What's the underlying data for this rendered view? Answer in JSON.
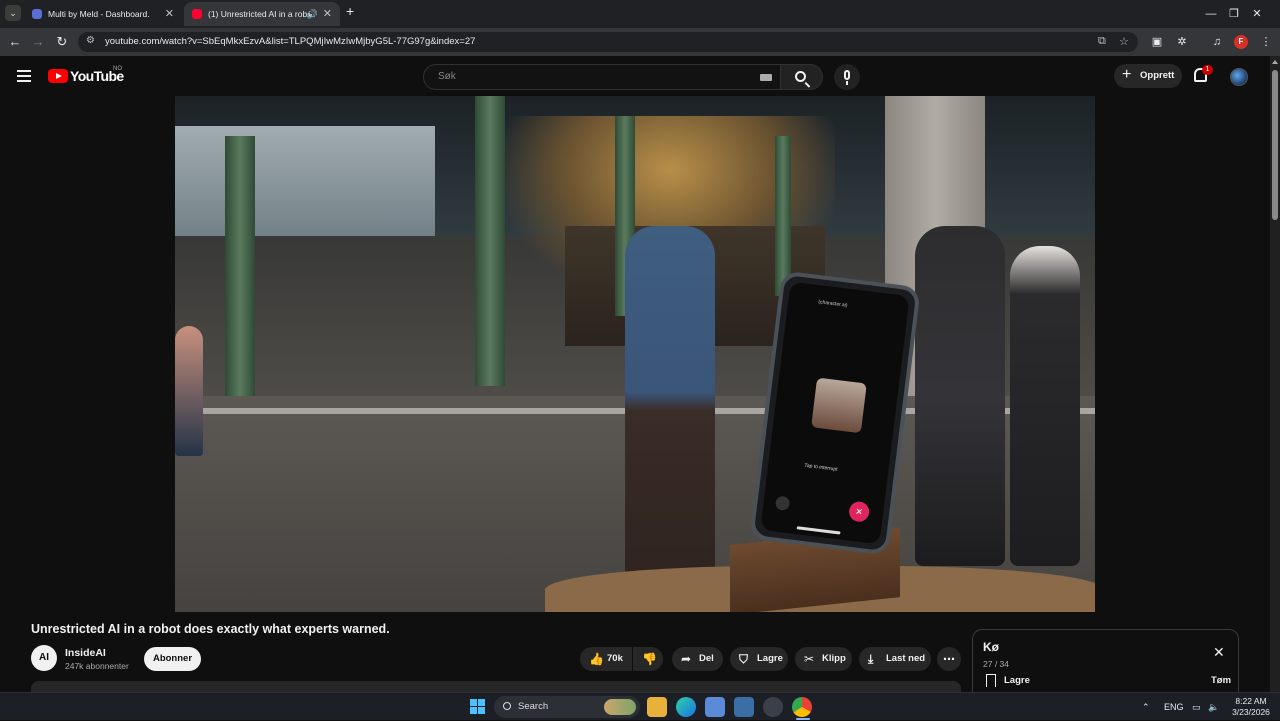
{
  "browser": {
    "tabs": [
      {
        "title": "Multi by Meld - Dashboard.",
        "close": "✕"
      },
      {
        "title": "(1) Unrestricted AI in a robo",
        "close": "✕"
      }
    ],
    "new_tab": "+",
    "url": "youtube.com/watch?v=SbEqMkxEzvA&list=TLPQMjIwMzIwMjbyG5L-77G97g&index=27",
    "profile_initial": "F",
    "window_controls": {
      "minimize": "—",
      "restore": "❐",
      "close": "✕"
    },
    "nav": {
      "back": "←",
      "forward": "→",
      "reload": "↻"
    }
  },
  "youtube": {
    "logo_text": "YouTube",
    "country": "NO",
    "search_placeholder": "Søk",
    "create_label": "Opprett",
    "notification_count": "1"
  },
  "video": {
    "title": "Unrestricted AI in a robot does exactly what experts warned.",
    "channel": {
      "name": "InsideAI",
      "avatar_text": "AI",
      "subscribers": "247k abonnenter"
    },
    "subscribe_label": "Abonner",
    "actions": {
      "like_count": "70k",
      "share": "Del",
      "save": "Lagre",
      "clip": "Klipp",
      "download": "Last ned",
      "more": "⋯"
    },
    "phone_overlay": {
      "header": "(character.ai)",
      "hint": "Tap to interrupt",
      "end": "End",
      "mute": "Mute"
    }
  },
  "queue": {
    "title": "Kø",
    "position": "27 / 34",
    "save_label": "Lagre",
    "clear_label": "Tøm",
    "close": "✕"
  },
  "taskbar": {
    "search_label": "Search",
    "language": "ENG",
    "time": "8:22 AM",
    "date": "3/23/2026"
  }
}
